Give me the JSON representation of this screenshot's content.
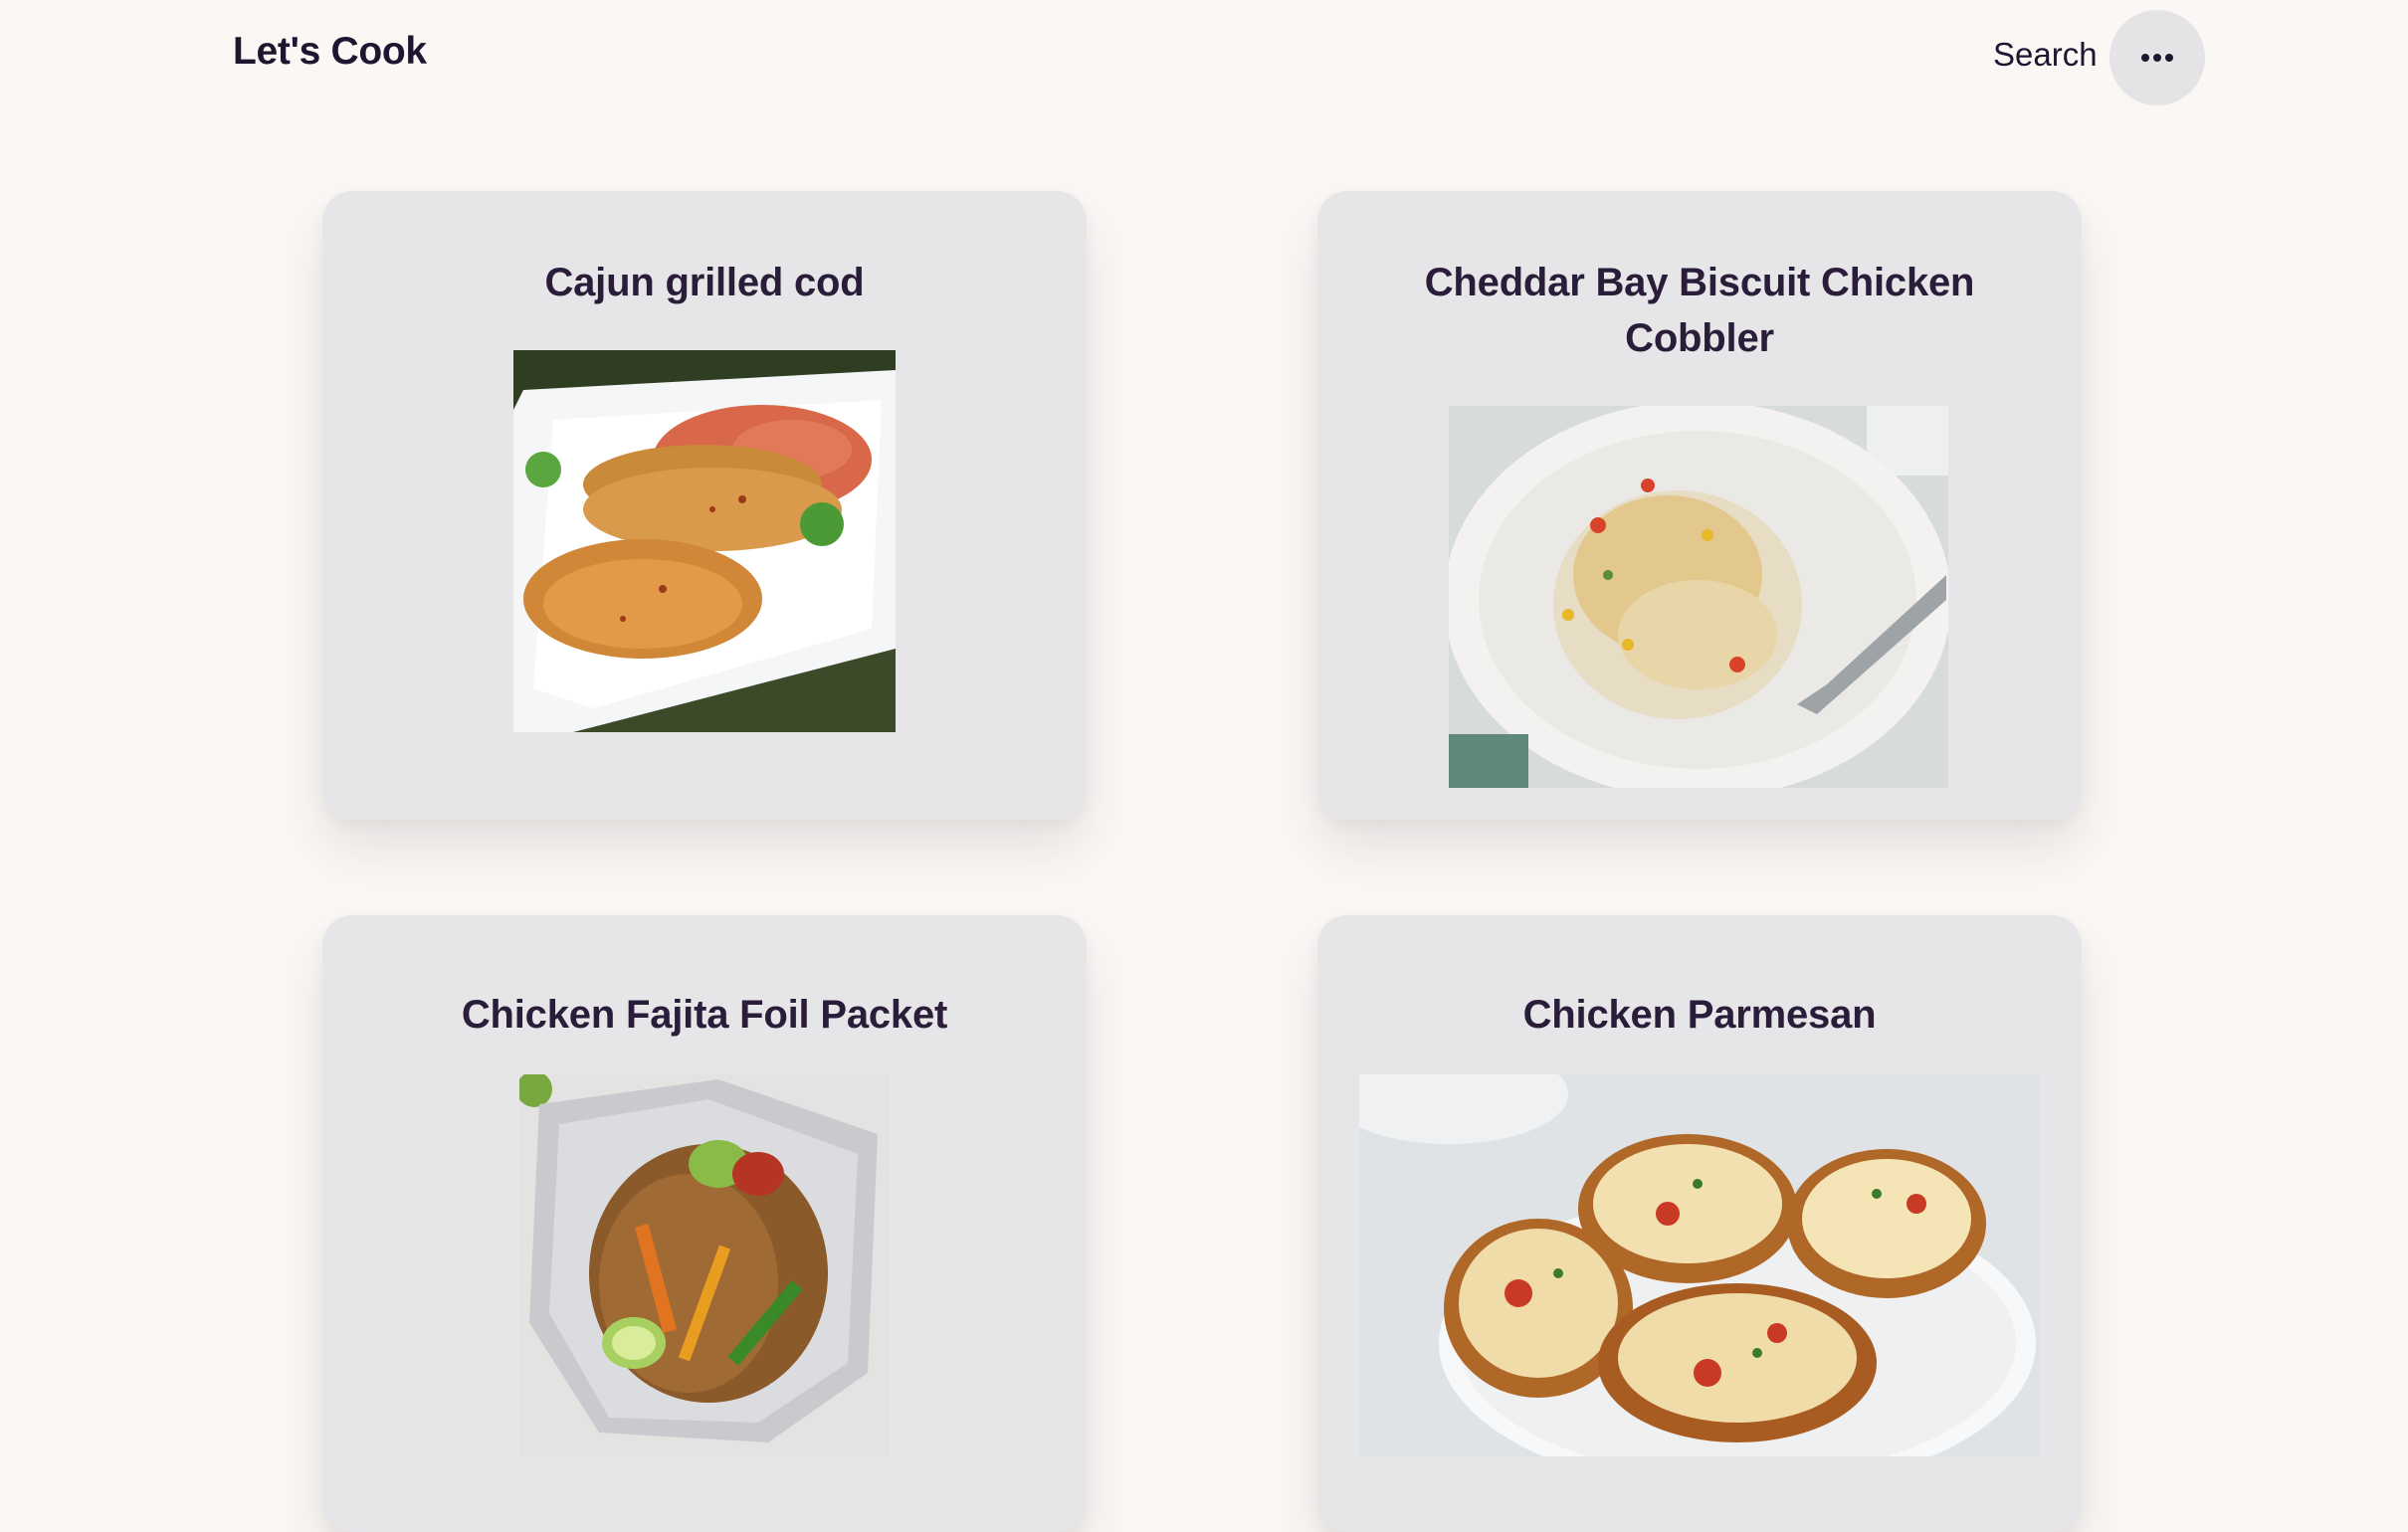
{
  "header": {
    "brand": "Let's Cook",
    "search_label": "Search",
    "menu_icon": "more-horizontal-icon"
  },
  "recipes": [
    {
      "title": "Cajun grilled cod"
    },
    {
      "title": "Cheddar Bay Biscuit Chicken Cobbler"
    },
    {
      "title": "Chicken Fajita Foil Packet"
    },
    {
      "title": "Chicken Parmesan"
    }
  ],
  "colors": {
    "background": "#faf7f5",
    "card": "#e6e5e8",
    "text": "#1f1530",
    "menu_button": "#e4e3e6"
  }
}
